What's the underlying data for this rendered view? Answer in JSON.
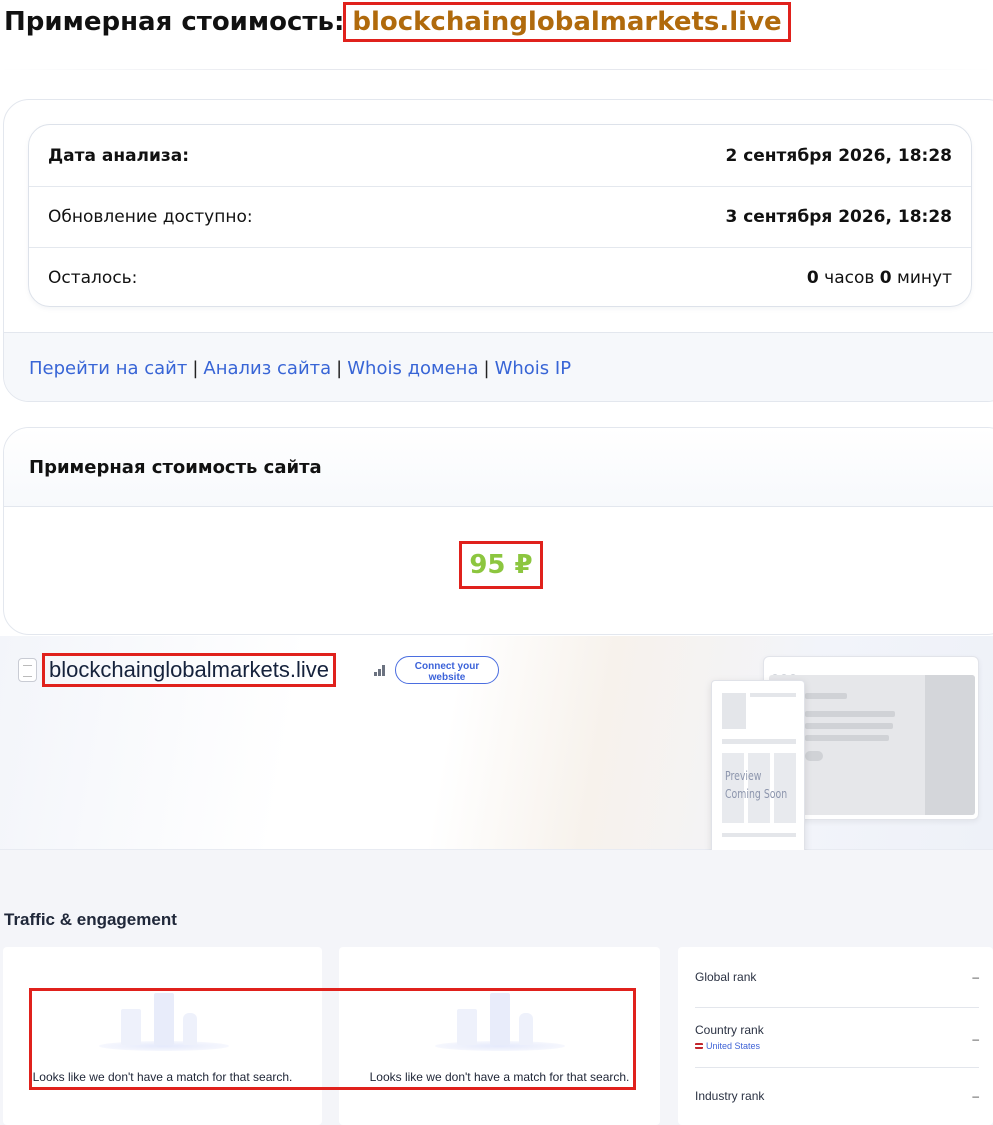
{
  "header": {
    "title_prefix": "Примерная стоимость:",
    "domain": "blockchainglobalmarkets.live"
  },
  "info": {
    "rows": [
      {
        "label": "Дата анализа:",
        "value": "2 сентября 2026, 18:28"
      },
      {
        "label": "Обновление доступно:",
        "value": "3 сентября 2026, 18:28"
      }
    ],
    "remaining": {
      "label": "Осталось:",
      "hours": "0",
      "hours_unit": "часов",
      "minutes": "0",
      "minutes_unit": "минут"
    }
  },
  "links": {
    "goto_site": "Перейти на сайт",
    "site_analysis": "Анализ сайта",
    "whois_domain": "Whois домена",
    "whois_ip": "Whois IP",
    "separator": "|"
  },
  "cost": {
    "heading": "Примерная стоимость сайта",
    "value": "95 ₽",
    "value_color": "#8cc63f"
  },
  "hero": {
    "site": "blockchainglobalmarkets.live",
    "connect_label": "Connect your website",
    "preview_line1": "Preview",
    "preview_line2": "Coming Soon"
  },
  "traffic": {
    "title": "Traffic & engagement",
    "empty_message": "Looks like we don't have a match for that search.",
    "ranks": [
      {
        "label": "Global rank",
        "value": "–"
      },
      {
        "label": "Country rank",
        "value": "–",
        "sub": "United States"
      },
      {
        "label": "Industry rank",
        "value": "–"
      }
    ]
  },
  "colors": {
    "link": "#3865d6",
    "domain_title": "#b06a0c",
    "highlight": "#e0211c"
  }
}
